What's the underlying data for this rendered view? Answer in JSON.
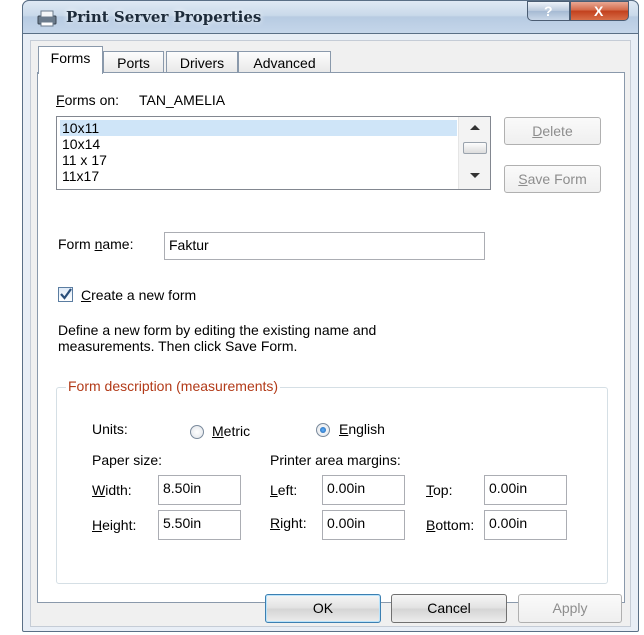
{
  "window": {
    "title": "Print Server Properties",
    "help_glyph": "?",
    "close_glyph": "X"
  },
  "tabs": [
    {
      "label": "Forms"
    },
    {
      "label": "Ports"
    },
    {
      "label": "Drivers"
    },
    {
      "label": "Advanced"
    }
  ],
  "forms_on": {
    "label_pre": "F",
    "label_post": "orms on:",
    "server": "TAN_AMELIA"
  },
  "forms_list": {
    "items": [
      "10x11",
      "10x14",
      "11 x 17",
      "11x17"
    ],
    "selected": "10x11"
  },
  "buttons": {
    "delete_pre": "",
    "delete_u": "D",
    "delete_post": "elete",
    "save_pre": "",
    "save_u": "S",
    "save_post": "ave Form",
    "ok": "OK",
    "cancel": "Cancel",
    "apply": "Apply"
  },
  "form_name": {
    "label_pre": "Form ",
    "label_u": "n",
    "label_post": "ame:",
    "value": "Faktur"
  },
  "create_new": {
    "checked": true,
    "label_u": "C",
    "label_post": "reate a new form"
  },
  "instructions": {
    "line1": "Define a new form by editing the existing name and",
    "line2": "measurements.  Then click Save Form."
  },
  "description": {
    "title": "Form description (measurements)",
    "units_label": "Units:",
    "metric_u": "M",
    "metric_post": "etric",
    "english_u": "E",
    "english_post": "nglish",
    "selected_unit": "English",
    "paper_size_label": "Paper size:",
    "margins_label": "Printer area margins:",
    "width_u": "W",
    "width_post": "idth:",
    "width_value": "8.50in",
    "height_u": "H",
    "height_post": "eight:",
    "height_value": "5.50in",
    "left_u": "L",
    "left_post": "eft:",
    "left_value": "0.00in",
    "right_u": "R",
    "right_post": "ight:",
    "right_value": "0.00in",
    "top_u": "T",
    "top_post": "op:",
    "top_value": "0.00in",
    "bottom_u": "B",
    "bottom_post": "ottom:",
    "bottom_value": "0.00in"
  },
  "colors": {
    "accent_title": "#b23a18",
    "selection": "#cfe5f8",
    "close_button": "#c2401d"
  }
}
